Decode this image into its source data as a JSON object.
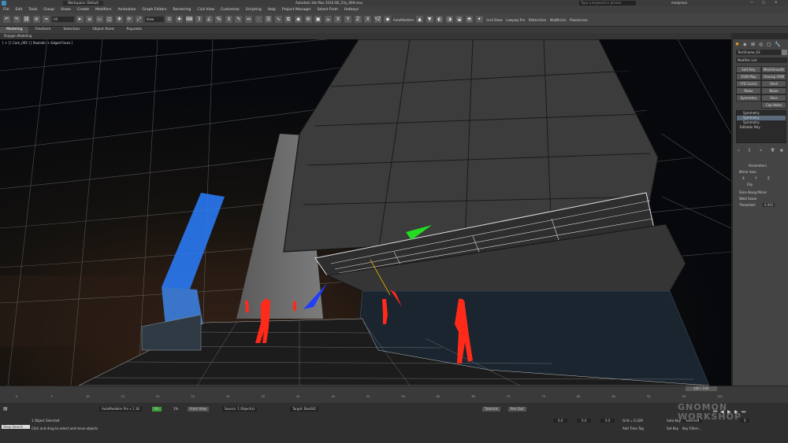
{
  "app": {
    "title": "Autodesk 3ds Max 2016   SIE_City_009.max",
    "workspace": "Workspace: Default",
    "search_placeholder": "Type a keyword or phrase",
    "user": "modyman"
  },
  "menus": [
    "File",
    "Edit",
    "Tools",
    "Group",
    "Views",
    "Create",
    "Modifiers",
    "Animation",
    "Graph Editors",
    "Rendering",
    "Civil View",
    "Customize",
    "Scripting",
    "Help",
    "Project Manager",
    "Select From",
    "Hotkeys"
  ],
  "toolbar": {
    "selection_filter": "All",
    "view": "View",
    "right_items": [
      "AutoModeller",
      "Grid Show",
      "Lowpoly Pro",
      "PatternGen",
      "MadBricks",
      "PowerLines"
    ]
  },
  "ribbon": {
    "tabs": [
      "Modeling",
      "Freeform",
      "Selection",
      "Object Paint",
      "Populate"
    ],
    "active": "Modeling",
    "sub": "Polygon Modeling"
  },
  "viewport": {
    "label": "[ + ] [ Cam_005 ] [ Realistic + Edged Faces ]"
  },
  "cmdpanel": {
    "object_name": "TechFrame_03",
    "modifier_list": "Modifier List",
    "buttons": [
      "Edit Poly",
      "MeshSmooth",
      "UVW Map",
      "Unwrap UVW",
      "FFD 2x2x2",
      "Shell",
      "Relax",
      "Noise",
      "Symmetry",
      "Slice",
      "Cap Holes"
    ],
    "stack": [
      "Symmetry",
      "Symmetry",
      "Symmetry",
      "Editable Poly"
    ],
    "parameters_title": "Parameters",
    "mirror_axis": "Mirror Axis:",
    "axes": [
      "X",
      "Y",
      "Z"
    ],
    "flip": "Flip",
    "slice": "Slice Along Mirror",
    "weld": "Weld Seam",
    "threshold_label": "Threshold:",
    "threshold_value": "0.001"
  },
  "timeline": {
    "frame": "100 / 100",
    "ticks": [
      "0",
      "5",
      "10",
      "15",
      "20",
      "25",
      "30",
      "35",
      "40",
      "45",
      "50",
      "55",
      "60",
      "65",
      "70",
      "75",
      "80",
      "85",
      "90",
      "95",
      "100"
    ]
  },
  "status": {
    "script": "AutoModeller Pro v 1.16",
    "on": "On",
    "percent": "1%",
    "front_view": "Front View",
    "source": "Source: 1 Object(s)",
    "target": "Target: Box042",
    "tutorials": "Tutorials",
    "tex_quit": "Pan Quit",
    "objects": "1 Object Selected",
    "hint": "Click and drag to select and move objects",
    "max_script": "Shop Search",
    "x": "0.0",
    "y": "0.0",
    "z": "0.0",
    "grid": "Grid = 0.328",
    "auto_key": "Auto Key",
    "selected": "Selected",
    "set_key": "Set Key",
    "key_filters": "Key Filters...",
    "add_time_tag": "Add Time Tag",
    "frame_num": "0"
  },
  "watermark": "GNOMON WORKSHOP",
  "colors": {
    "accent": "#4aa3df",
    "figures": "#ff2a1a",
    "wire": "#d0d0d0",
    "building_blue": "#2a7fff"
  }
}
